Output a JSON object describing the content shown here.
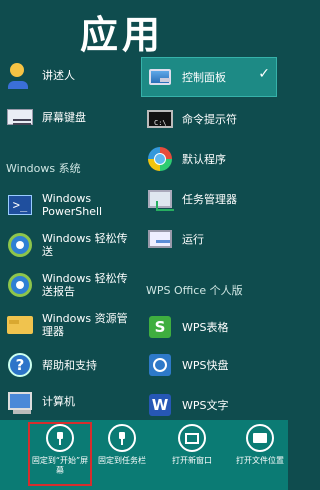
{
  "title": "应用",
  "left_column": {
    "items_top": [
      {
        "label": "讲述人",
        "icon": "narrator-icon"
      },
      {
        "label": "屏幕键盘",
        "icon": "on-screen-keyboard-icon"
      }
    ],
    "group_windows": "Windows 系统",
    "items_windows": [
      {
        "label": "Windows PowerShell",
        "icon": "powershell-icon"
      },
      {
        "label": "Windows 轻松传送",
        "icon": "easy-transfer-icon"
      },
      {
        "label": "Windows 轻松传送报告",
        "icon": "easy-transfer-report-icon"
      },
      {
        "label": "Windows 资源管理器",
        "icon": "explorer-folder-icon"
      },
      {
        "label": "帮助和支持",
        "icon": "help-icon"
      },
      {
        "label": "计算机",
        "icon": "computer-icon"
      }
    ]
  },
  "right_column": {
    "items_top": [
      {
        "label": "控制面板",
        "icon": "control-panel-icon",
        "selected": true
      },
      {
        "label": "命令提示符",
        "icon": "command-prompt-icon"
      },
      {
        "label": "默认程序",
        "icon": "default-programs-icon"
      },
      {
        "label": "任务管理器",
        "icon": "task-manager-icon"
      },
      {
        "label": "运行",
        "icon": "run-icon"
      }
    ],
    "group_wps": "WPS Office 个人版",
    "items_wps": [
      {
        "label": "WPS表格",
        "icon": "wps-spreadsheet-icon"
      },
      {
        "label": "WPS快盘",
        "icon": "wps-kuaipan-icon"
      },
      {
        "label": "WPS文字",
        "icon": "wps-writer-icon"
      }
    ]
  },
  "appbar": {
    "buttons": [
      {
        "label": "固定到“开始”屏幕",
        "icon": "pin-icon",
        "highlighted": true
      },
      {
        "label": "固定到任务栏",
        "icon": "pin-taskbar-icon"
      },
      {
        "label": "打开新窗口",
        "icon": "new-window-icon"
      },
      {
        "label": "打开文件位置",
        "icon": "open-folder-icon"
      }
    ]
  },
  "colors": {
    "background": "#0f4c4e",
    "selected_tile": "#1d8a85",
    "appbar": "#0b7b74",
    "highlight_border": "#d62d2d"
  }
}
